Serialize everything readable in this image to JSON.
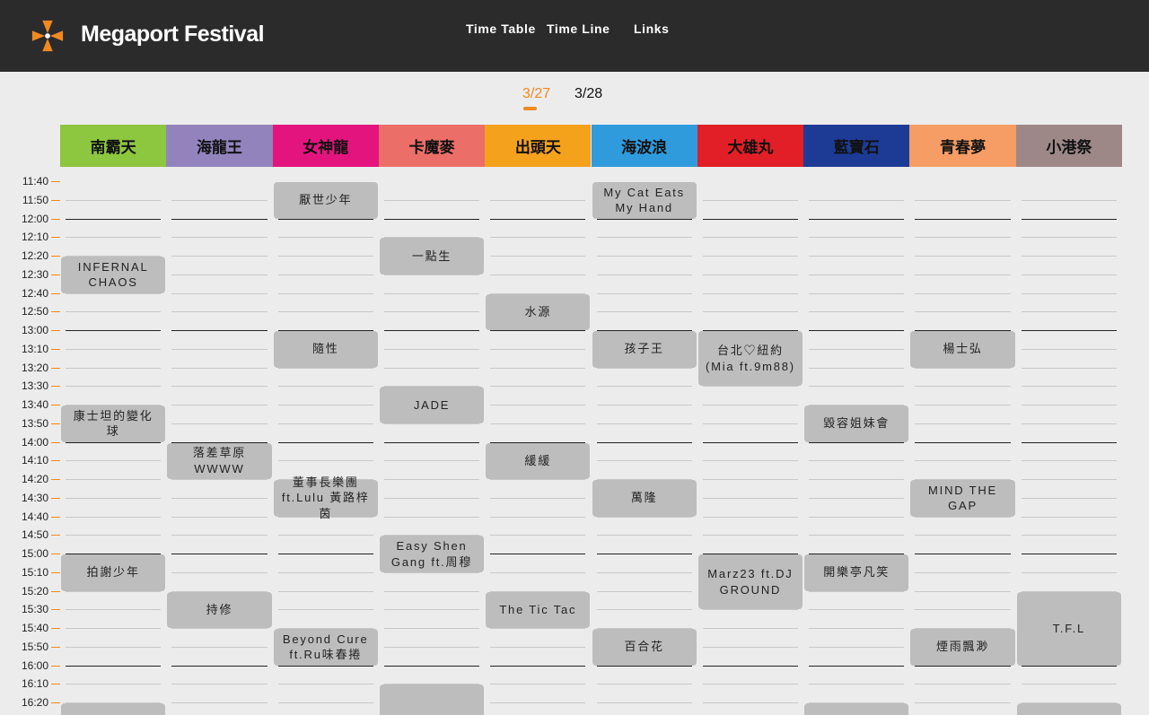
{
  "brand": {
    "name": "Megaport Festival",
    "logo_colors": [
      "#f0891f",
      "#ffffff"
    ]
  },
  "nav": [
    {
      "label": "Time Table"
    },
    {
      "label": "Time Line"
    },
    {
      "label": "Links"
    }
  ],
  "date_tabs": [
    {
      "label": "3/27",
      "active": true
    },
    {
      "label": "3/28",
      "active": false
    }
  ],
  "stages": [
    {
      "name": "南霸天",
      "color": "#8dc63f"
    },
    {
      "name": "海龍王",
      "color": "#9383bd"
    },
    {
      "name": "女神龍",
      "color": "#e4147f"
    },
    {
      "name": "卡魔麥",
      "color": "#ec6e68"
    },
    {
      "name": "出頭天",
      "color": "#f4a11c"
    },
    {
      "name": "海波浪",
      "color": "#2f9bdc"
    },
    {
      "name": "大雄丸",
      "color": "#e21e26"
    },
    {
      "name": "藍寶石",
      "color": "#1d3b95"
    },
    {
      "name": "青春夢",
      "color": "#f59d64"
    },
    {
      "name": "小港祭",
      "color": "#9d8887"
    }
  ],
  "times": [
    "11:40",
    "11:50",
    "12:00",
    "12:10",
    "12:20",
    "12:30",
    "12:40",
    "12:50",
    "13:00",
    "13:10",
    "13:20",
    "13:30",
    "13:40",
    "13:50",
    "14:00",
    "14:10",
    "14:20",
    "14:30",
    "14:40",
    "14:50",
    "15:00",
    "15:10",
    "15:20",
    "15:30",
    "15:40",
    "15:50",
    "16:00",
    "16:10",
    "16:20"
  ],
  "performances": [
    {
      "stage": 0,
      "name": "INFERNAL CHAOS",
      "start": "12:20",
      "end": "12:40"
    },
    {
      "stage": 0,
      "name": "康士坦的變化球",
      "start": "13:40",
      "end": "14:00"
    },
    {
      "stage": 0,
      "name": "拍謝少年",
      "start": "15:00",
      "end": "15:20"
    },
    {
      "stage": 0,
      "name": "",
      "start": "16:20",
      "end": "16:40"
    },
    {
      "stage": 1,
      "name": "落差草原WWWW",
      "start": "14:00",
      "end": "14:20"
    },
    {
      "stage": 1,
      "name": "持修",
      "start": "15:20",
      "end": "15:40"
    },
    {
      "stage": 2,
      "name": "厭世少年",
      "start": "11:40",
      "end": "12:00"
    },
    {
      "stage": 2,
      "name": "隨性",
      "start": "13:00",
      "end": "13:20"
    },
    {
      "stage": 2,
      "name": "董事長樂團 ft.Lulu 黃路梓茵",
      "start": "14:20",
      "end": "14:40"
    },
    {
      "stage": 2,
      "name": "Beyond Cure ft.Ru味春捲",
      "start": "15:40",
      "end": "16:00"
    },
    {
      "stage": 3,
      "name": "一點生",
      "start": "12:10",
      "end": "12:30"
    },
    {
      "stage": 3,
      "name": "JADE",
      "start": "13:30",
      "end": "13:50"
    },
    {
      "stage": 3,
      "name": "Easy Shen Gang ft.周穆",
      "start": "14:50",
      "end": "15:10"
    },
    {
      "stage": 3,
      "name": "",
      "start": "16:10",
      "end": "16:40"
    },
    {
      "stage": 4,
      "name": "水源",
      "start": "12:40",
      "end": "13:00"
    },
    {
      "stage": 4,
      "name": "緩緩",
      "start": "14:00",
      "end": "14:20"
    },
    {
      "stage": 4,
      "name": "The Tic Tac",
      "start": "15:20",
      "end": "15:40"
    },
    {
      "stage": 5,
      "name": "My Cat Eats My Hand",
      "start": "11:40",
      "end": "12:00"
    },
    {
      "stage": 5,
      "name": "孩子王",
      "start": "13:00",
      "end": "13:20"
    },
    {
      "stage": 5,
      "name": "萬隆",
      "start": "14:20",
      "end": "14:40"
    },
    {
      "stage": 5,
      "name": "百合花",
      "start": "15:40",
      "end": "16:00"
    },
    {
      "stage": 6,
      "name": "台北♡紐約 (Mia ft.9m88)",
      "start": "13:00",
      "end": "13:30"
    },
    {
      "stage": 6,
      "name": "Marz23 ft.DJ GROUND",
      "start": "15:00",
      "end": "15:30"
    },
    {
      "stage": 7,
      "name": "毀容姐妹會",
      "start": "13:40",
      "end": "14:00"
    },
    {
      "stage": 7,
      "name": "開樂亭凡笑",
      "start": "15:00",
      "end": "15:20"
    },
    {
      "stage": 7,
      "name": "",
      "start": "16:20",
      "end": "16:40"
    },
    {
      "stage": 8,
      "name": "楊士弘",
      "start": "13:00",
      "end": "13:20"
    },
    {
      "stage": 8,
      "name": "MIND THE GAP",
      "start": "14:20",
      "end": "14:40"
    },
    {
      "stage": 8,
      "name": "煙雨飄渺",
      "start": "15:40",
      "end": "16:00"
    },
    {
      "stage": 9,
      "name": "T.F.L",
      "start": "15:20",
      "end": "16:00"
    },
    {
      "stage": 9,
      "name": "",
      "start": "16:20",
      "end": "16:40"
    }
  ]
}
